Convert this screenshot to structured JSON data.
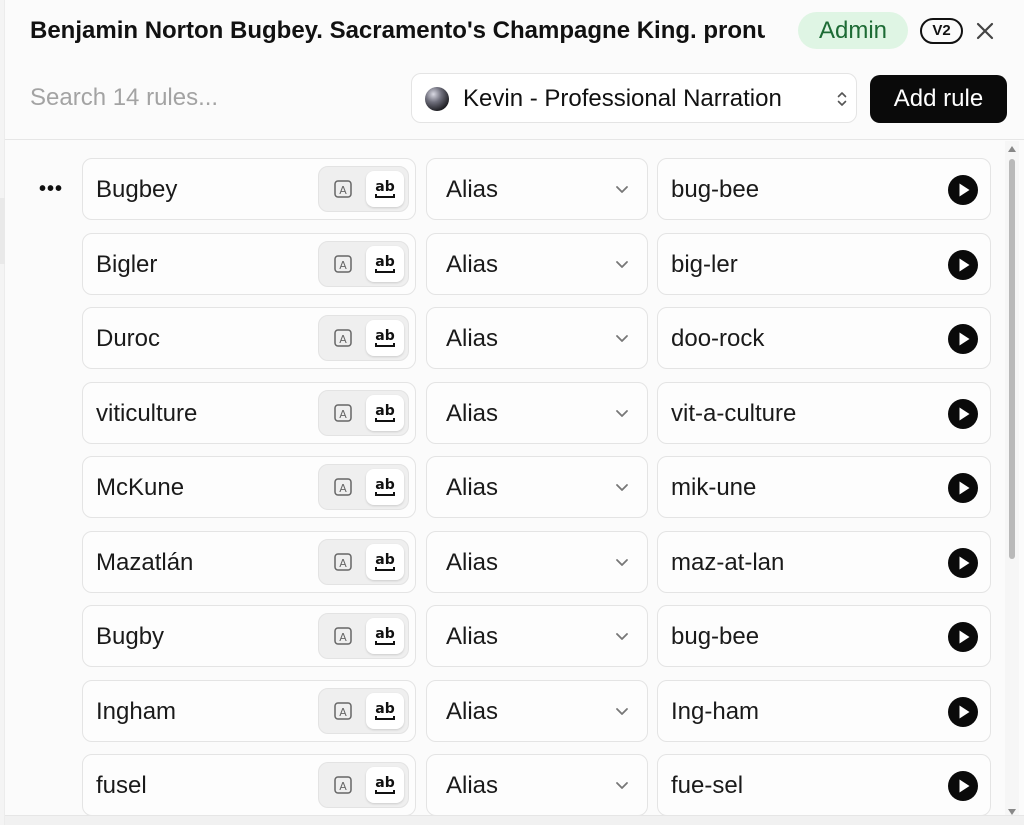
{
  "header": {
    "title": "Benjamin Norton Bugbey. Sacramento's Champagne King. pronunciation rules",
    "admin_badge": "Admin",
    "version_badge": "V2"
  },
  "toolbar": {
    "search_placeholder": "Search 14 rules...",
    "voice_label": "Kevin - Professional Narration",
    "add_rule_label": "Add rule"
  },
  "rules": [
    {
      "term": "Bugbey",
      "type": "Alias",
      "alias": "bug-bee"
    },
    {
      "term": "Bigler",
      "type": "Alias",
      "alias": "big-ler"
    },
    {
      "term": "Duroc",
      "type": "Alias",
      "alias": "doo-rock"
    },
    {
      "term": "viticulture",
      "type": "Alias",
      "alias": "vit-a-culture"
    },
    {
      "term": "McKune",
      "type": "Alias",
      "alias": "mik-une"
    },
    {
      "term": "Mazatlán",
      "type": "Alias",
      "alias": "maz-at-lan"
    },
    {
      "term": "Bugby",
      "type": "Alias",
      "alias": "bug-bee"
    },
    {
      "term": "Ingham",
      "type": "Alias",
      "alias": "Ing-ham"
    },
    {
      "term": "fusel",
      "type": "Alias",
      "alias": "fue-sel"
    }
  ],
  "icons": {
    "case_sensitive": "letter-a-box-icon",
    "case_insensitive": "ab-underline-icon",
    "play": "play-circle-icon",
    "more": "ellipsis-icon",
    "close": "close-icon"
  },
  "colors": {
    "admin_badge_bg": "#dff5e4",
    "admin_badge_text": "#1d6b35",
    "primary_button": "#0a0a0a"
  }
}
